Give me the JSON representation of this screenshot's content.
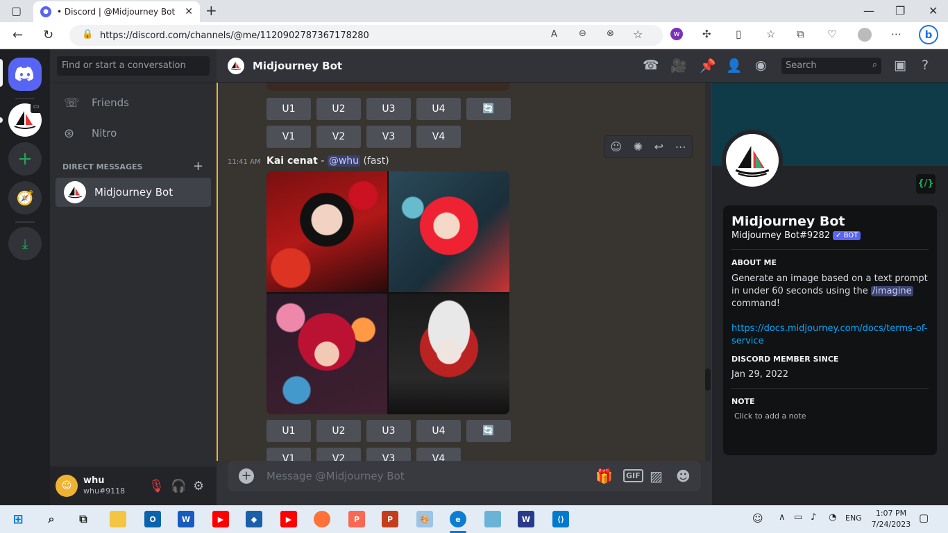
{
  "browser": {
    "tab_title": "• Discord | @Midjourney Bot",
    "url": "https://discord.com/channels/@me/1120902787367178280",
    "new_tab": "+",
    "tab_close": "✕"
  },
  "dm_sidebar": {
    "search_placeholder": "Find or start a conversation",
    "friends": "Friends",
    "nitro": "Nitro",
    "direct_messages": "DIRECT MESSAGES",
    "add_dm": "+",
    "active_dm": "Midjourney Bot"
  },
  "user_panel": {
    "name": "whu",
    "tag": "whu#9118"
  },
  "header": {
    "channel_name": "Midjourney Bot",
    "search_placeholder": "Search"
  },
  "message": {
    "time": "11:41 AM",
    "author": "Kai cenat",
    "separator": " - ",
    "mention": "@whu",
    "speed": "(fast)",
    "upscale_buttons": [
      "U1",
      "U2",
      "U3",
      "U4"
    ],
    "variation_buttons": [
      "V1",
      "V2",
      "V3",
      "V4"
    ],
    "reroll_icon": "🔄"
  },
  "composer": {
    "placeholder": "Message @Midjourney Bot",
    "gif": "GIF"
  },
  "profile": {
    "name": "Midjourney Bot",
    "tag": "Midjourney Bot#9282",
    "bot_badge": "✓ BOT",
    "about_heading": "ABOUT ME",
    "about_text_1": "Generate an image based on a text prompt in under 60 seconds using the",
    "about_command": "/imagine",
    "about_text_2": "command!",
    "link": "https://docs.midjourney.com/docs/terms-of-service",
    "member_since_heading": "DISCORD MEMBER SINCE",
    "member_since": "Jan 29, 2022",
    "note_heading": "NOTE",
    "note_placeholder": "Click to add a note",
    "dev_badge": "{/}"
  },
  "taskbar": {
    "lang": "ENG",
    "time": "1:07 PM",
    "date": "7/24/2023"
  },
  "colors": {
    "blurple": "#5865f2",
    "green": "#23a559",
    "accent_highlight": "#f0b232",
    "link": "#00a8fc"
  }
}
